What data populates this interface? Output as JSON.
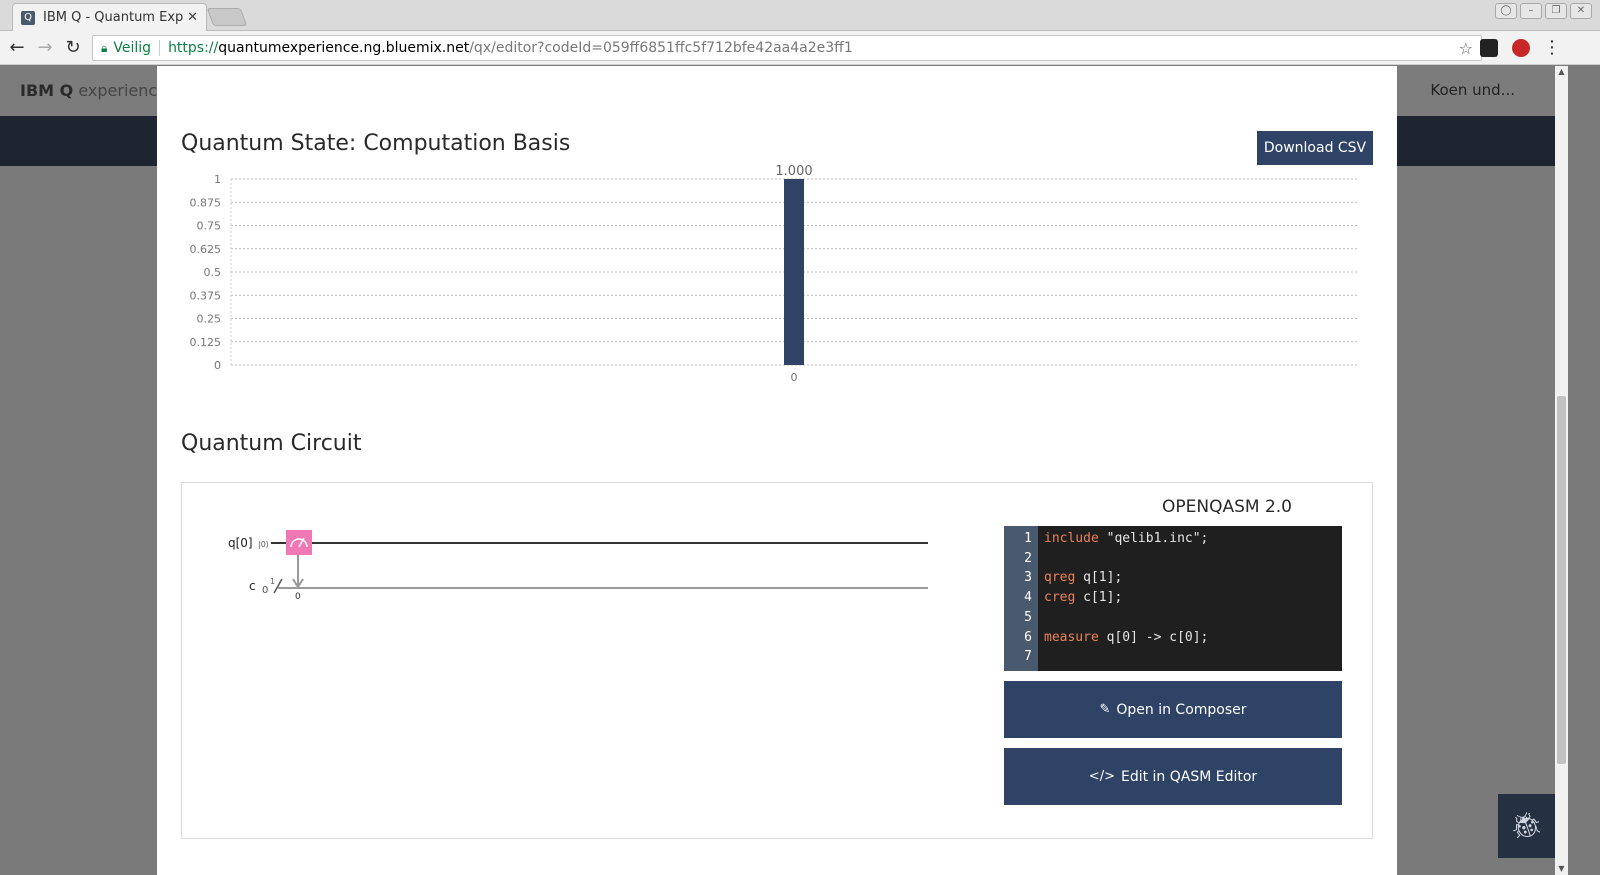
{
  "browser": {
    "tab_title": "IBM Q - Quantum Exp",
    "tab_favicon": "Q",
    "secure_label": "Veilig",
    "url_scheme": "https://",
    "url_host": "quantumexperience.ng.bluemix.net",
    "url_path": "/qx/editor?codeId=059ff6851ffc5f712bfe42aa4a2e3ff1"
  },
  "page": {
    "brand_bold": "IBM Q",
    "brand_light": "experience",
    "user": "Koen und..."
  },
  "modal": {
    "state_title": "Quantum State: Computation Basis",
    "download_label": "Download CSV",
    "circuit_title": "Quantum Circuit",
    "qasm_title": "OPENQASM 2.0",
    "open_composer_label": "Open in Composer",
    "edit_qasm_label": "Edit in QASM Editor"
  },
  "chart_data": {
    "type": "bar",
    "categories": [
      "0"
    ],
    "values": [
      1.0
    ],
    "data_labels": [
      "1.000"
    ],
    "title": "Quantum State: Computation Basis",
    "xlabel": "",
    "ylabel": "",
    "ylim": [
      0,
      1
    ],
    "yticks": [
      "0",
      "0.125",
      "0.25",
      "0.375",
      "0.5",
      "0.625",
      "0.75",
      "0.875",
      "1"
    ],
    "grid": true,
    "bar_color": "#2e4365"
  },
  "circuit": {
    "qubit_label": "q[0]",
    "qubit_init": "|0⟩",
    "creg_label": "c",
    "creg_init": "0",
    "creg_size": "1",
    "measure_index": "0",
    "gate_color": "#f078b4"
  },
  "qasm_lines": [
    {
      "n": "1",
      "kw": "include",
      "rest": " \"qelib1.inc\";"
    },
    {
      "n": "2",
      "kw": "",
      "rest": ""
    },
    {
      "n": "3",
      "kw": "qreg",
      "rest": " q[1];"
    },
    {
      "n": "4",
      "kw": "creg",
      "rest": " c[1];"
    },
    {
      "n": "5",
      "kw": "",
      "rest": ""
    },
    {
      "n": "6",
      "kw": "measure",
      "rest": " q[0] -> c[0];"
    },
    {
      "n": "7",
      "kw": "",
      "rest": ""
    }
  ]
}
